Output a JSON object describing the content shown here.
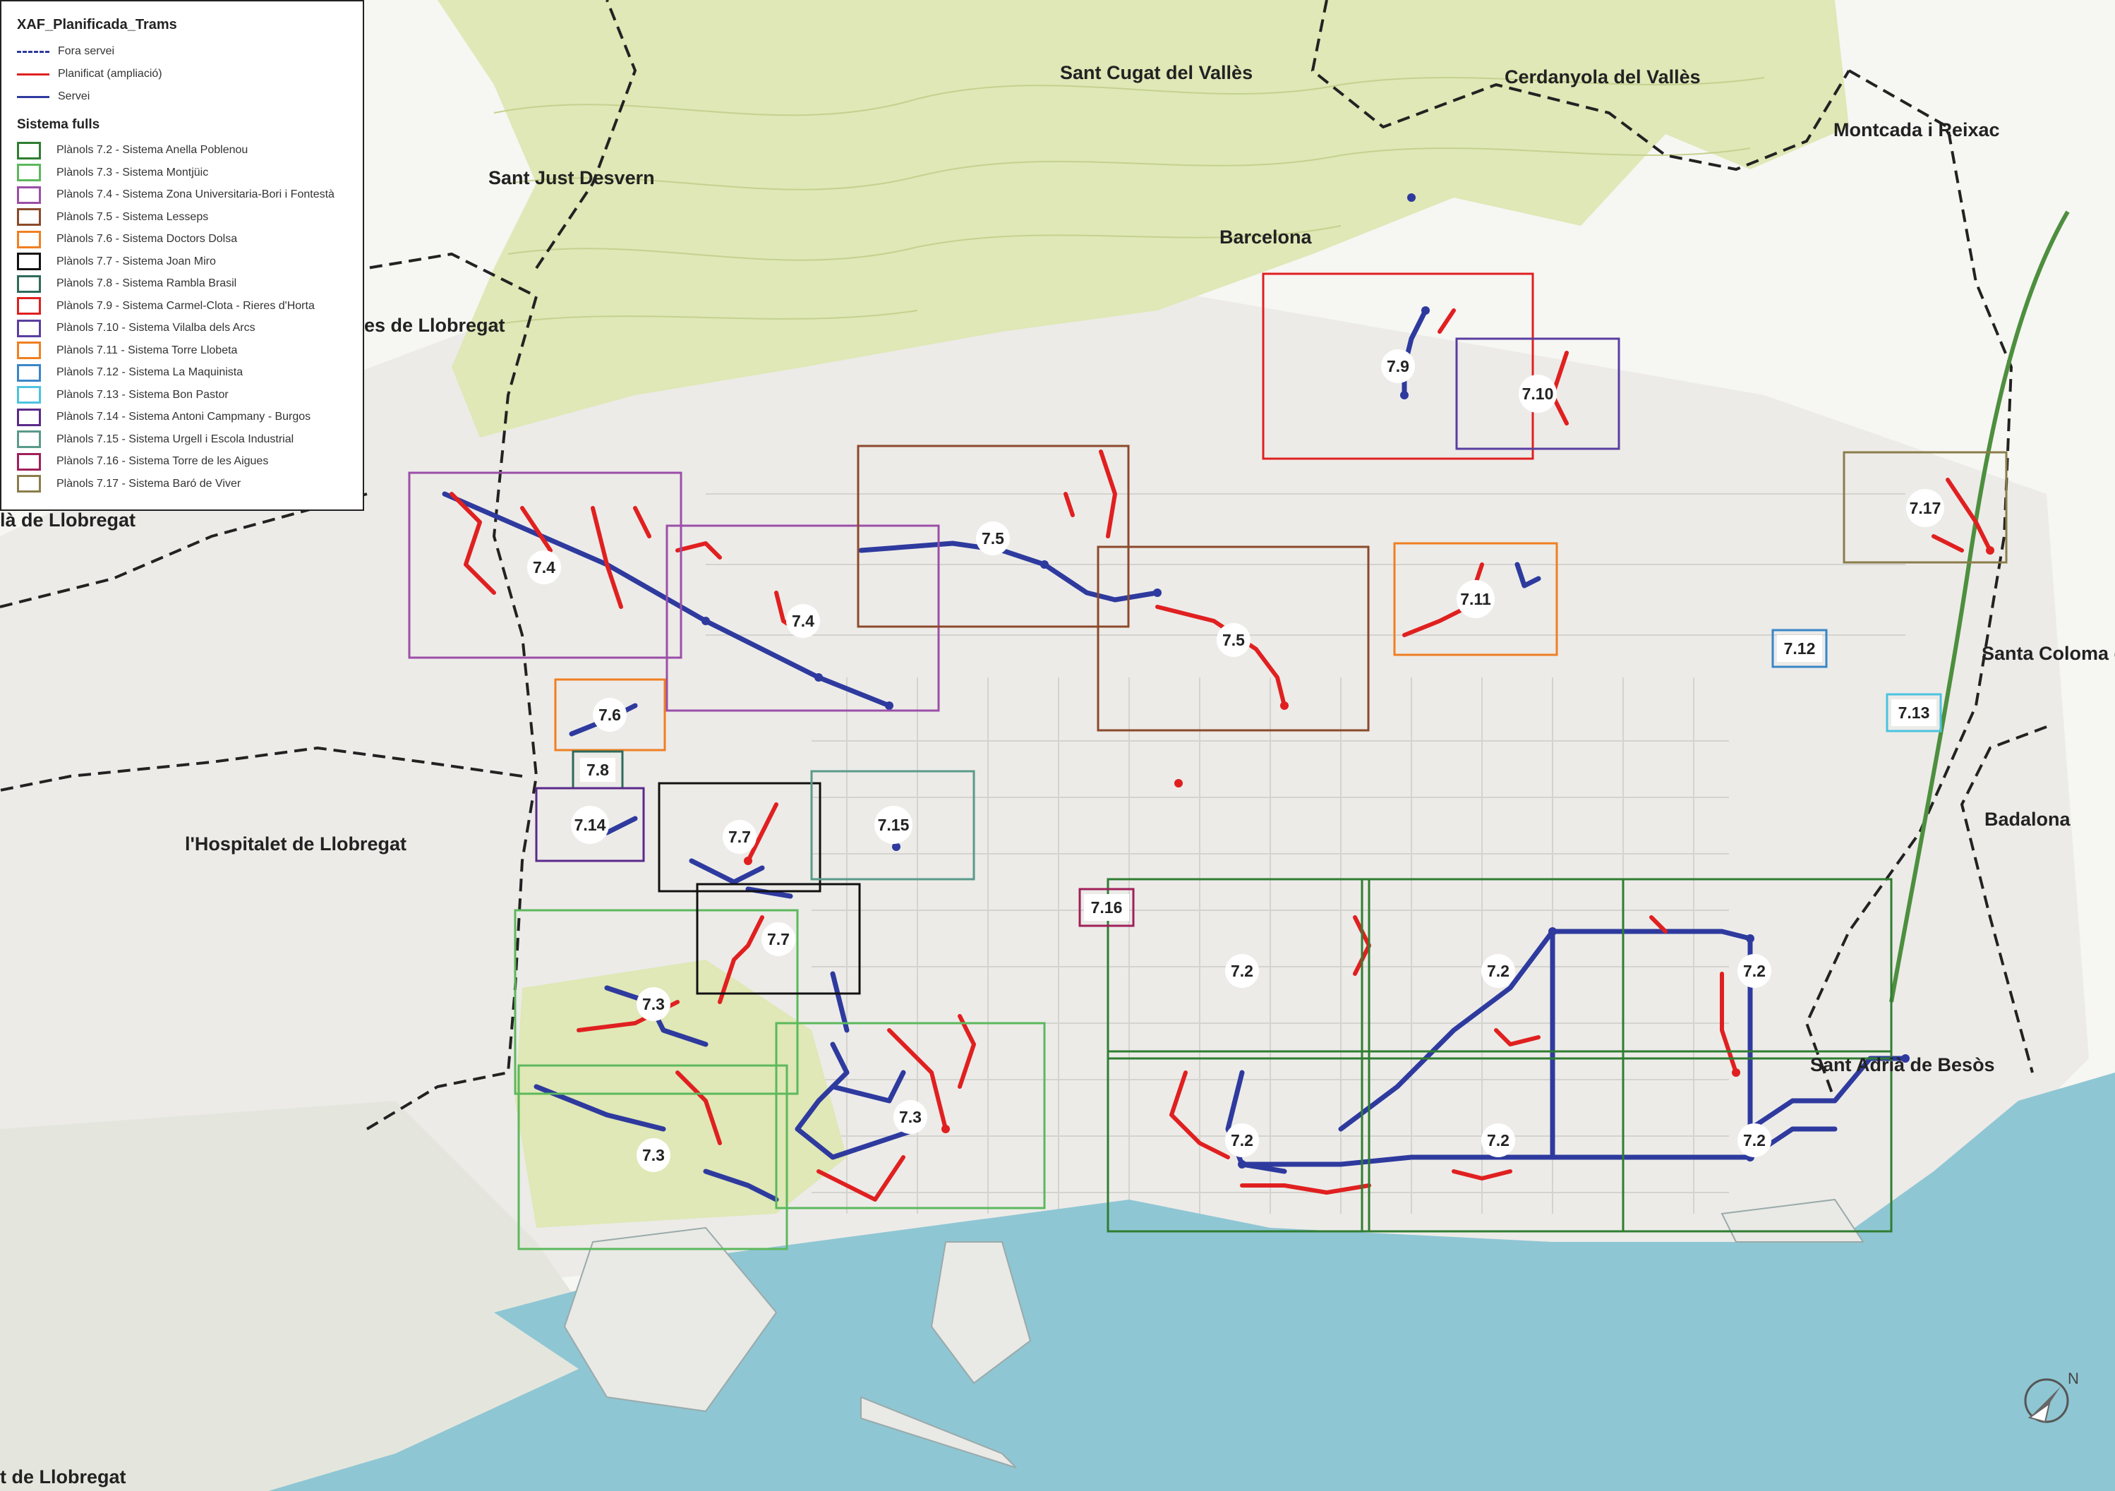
{
  "legend": {
    "title": "XAF_Planificada_Trams",
    "line_items": [
      {
        "label": "Fora servei",
        "color": "#2e3a9e",
        "style": "dashed"
      },
      {
        "label": "Planificat (ampliació)",
        "color": "#e02020",
        "style": "solid"
      },
      {
        "label": "Servei",
        "color": "#2e3a9e",
        "style": "solid"
      }
    ],
    "section_title": "Sistema fulls",
    "sheet_items": [
      {
        "label": "Plànols 7.2 - Sistema Anella Poblenou",
        "color": "#2f7d32"
      },
      {
        "label": "Plànols 7.3 - Sistema Montjüic",
        "color": "#5cb85c"
      },
      {
        "label": "Plànols 7.4 - Sistema Zona Universitaria-Bori i Fontestà",
        "color": "#9b4fa8"
      },
      {
        "label": "Plànols 7.5 - Sistema Lesseps",
        "color": "#8b4a2b"
      },
      {
        "label": "Plànols 7.6 - Sistema Doctors Dolsa",
        "color": "#f07f22"
      },
      {
        "label": "Plànols 7.7 - Sistema Joan Miro",
        "color": "#111111"
      },
      {
        "label": "Plànols 7.8 - Sistema Rambla Brasil",
        "color": "#2e6b5a"
      },
      {
        "label": "Plànols 7.9 - Sistema Carmel-Clota - Rieres d'Horta",
        "color": "#e02020"
      },
      {
        "label": "Plànols 7.10 - Sistema Vilalba dels Arcs",
        "color": "#5a3ea0"
      },
      {
        "label": "Plànols 7.11 - Sistema Torre Llobeta",
        "color": "#f07f22"
      },
      {
        "label": "Plànols 7.12 - Sistema La Maquinista",
        "color": "#3a86c8"
      },
      {
        "label": "Plànols 7.13 - Sistema Bon Pastor",
        "color": "#4cc3e0"
      },
      {
        "label": "Plànols 7.14 - Sistema Antoni Campmany - Burgos",
        "color": "#5a2a8a"
      },
      {
        "label": "Plànols 7.15 - Sistema Urgell i Escola Industrial",
        "color": "#5a9a8a"
      },
      {
        "label": "Plànols 7.16 - Sistema Torre de les Aigues",
        "color": "#a0205a"
      },
      {
        "label": "Plànols 7.17 - Sistema Baró de Viver",
        "color": "#8b7d4a"
      }
    ]
  },
  "places": [
    {
      "name": "Sant Cugat del Vallès"
    },
    {
      "name": "Cerdanyola del Vallès"
    },
    {
      "name": "Montcada i Reixac"
    },
    {
      "name": "Sant Just Desvern"
    },
    {
      "name": "Barcelona"
    },
    {
      "name": "es de Llobregat"
    },
    {
      "name": "là  de Llobregat"
    },
    {
      "name": "l'Hospitalet de Llobregat"
    },
    {
      "name": "Santa Coloma d"
    },
    {
      "name": "Badalona"
    },
    {
      "name": "Sant Adrià  de Besòs"
    },
    {
      "name": "t de Llobregat"
    }
  ],
  "sheets": [
    {
      "label": "7.2",
      "color": "#2f7d32"
    },
    {
      "label": "7.3",
      "color": "#5cb85c"
    },
    {
      "label": "7.4",
      "color": "#9b4fa8"
    },
    {
      "label": "7.5",
      "color": "#8b4a2b"
    },
    {
      "label": "7.6",
      "color": "#f07f22"
    },
    {
      "label": "7.7",
      "color": "#111111"
    },
    {
      "label": "7.8",
      "color": "#2e6b5a"
    },
    {
      "label": "7.9",
      "color": "#e02020"
    },
    {
      "label": "7.10",
      "color": "#5a3ea0"
    },
    {
      "label": "7.11",
      "color": "#f07f22"
    },
    {
      "label": "7.12",
      "color": "#3a86c8"
    },
    {
      "label": "7.13",
      "color": "#4cc3e0"
    },
    {
      "label": "7.14",
      "color": "#5a2a8a"
    },
    {
      "label": "7.15",
      "color": "#5a9a8a"
    },
    {
      "label": "7.16",
      "color": "#a0205a"
    },
    {
      "label": "7.17",
      "color": "#8b7d4a"
    }
  ],
  "colors": {
    "sea": "#8fc6d3",
    "park": "#dfe8b6",
    "urban": "#ececea",
    "service_network": "#2e3a9e",
    "planned_network": "#e02020"
  },
  "icons": {
    "compass": "north-arrow-icon"
  }
}
